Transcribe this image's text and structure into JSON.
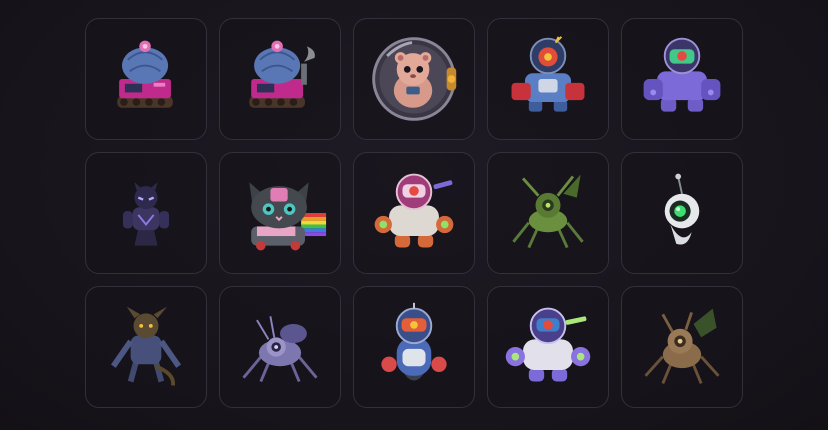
{
  "collection": {
    "items": [
      {
        "icon": "cactus-tank-icon"
      },
      {
        "icon": "cactus-steam-tank-icon"
      },
      {
        "icon": "hamster-ball-icon"
      },
      {
        "icon": "blue-mech-robot-icon"
      },
      {
        "icon": "purple-mech-robot-icon"
      },
      {
        "icon": "purple-panther-icon"
      },
      {
        "icon": "nyan-cat-robot-icon"
      },
      {
        "icon": "orange-white-robot-icon"
      },
      {
        "icon": "green-insect-drone-icon"
      },
      {
        "icon": "floating-orb-drone-icon"
      },
      {
        "icon": "werewolf-creature-icon"
      },
      {
        "icon": "purple-spider-bot-icon"
      },
      {
        "icon": "capsule-robot-icon"
      },
      {
        "icon": "purple-white-mech-icon"
      },
      {
        "icon": "brown-insect-bot-icon"
      }
    ]
  },
  "colors": {
    "background": "#17141b",
    "tile_border": "#34303b"
  }
}
